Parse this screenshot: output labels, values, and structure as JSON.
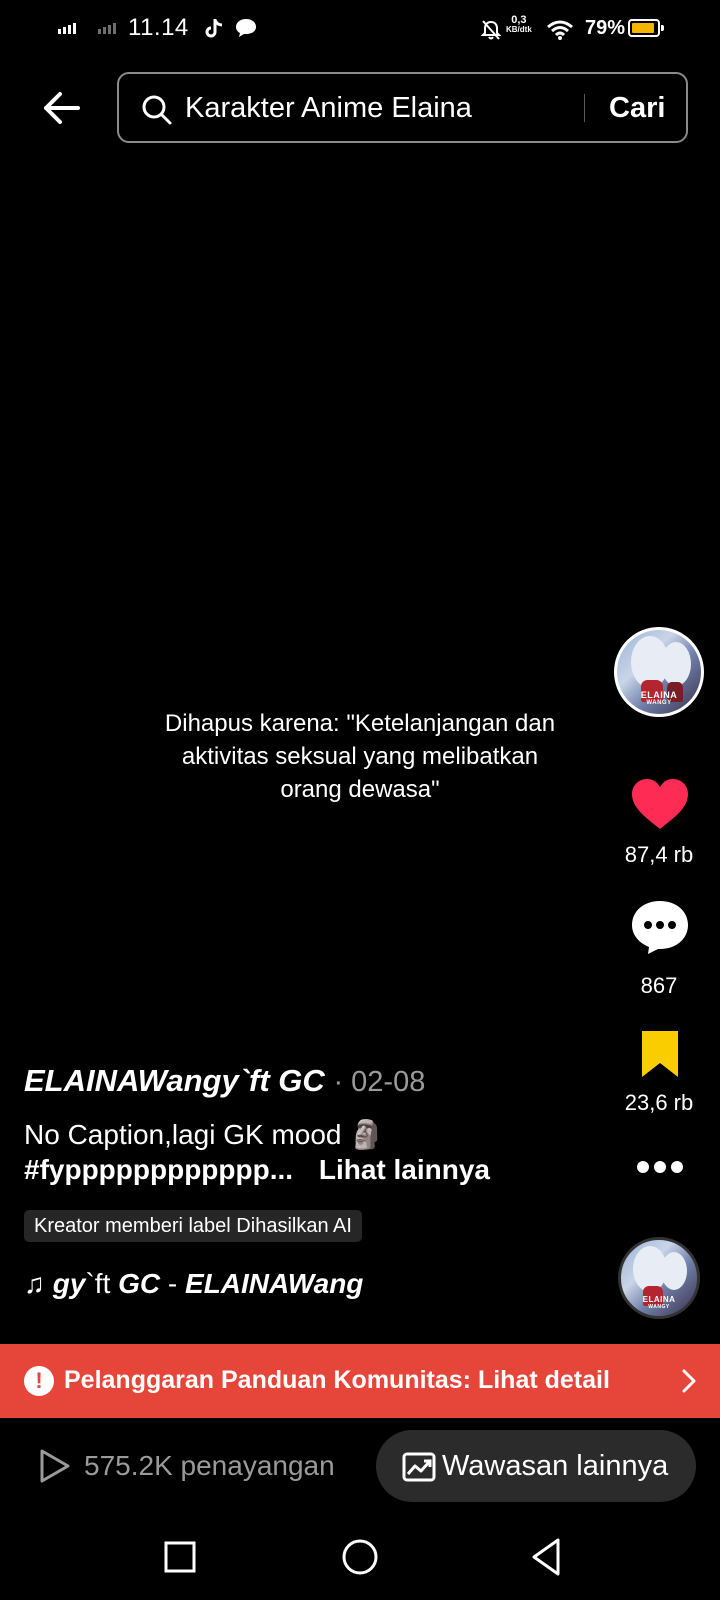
{
  "status_bar": {
    "time": "11.14",
    "net_speed_value": "0,3",
    "net_speed_unit": "KB/dtk",
    "battery_percent": "79%",
    "battery_level": 0.79,
    "icons": [
      "signal-icon",
      "signal-secondary-icon",
      "tiktok-icon",
      "chat-bubble-icon",
      "mute-bell-icon",
      "wifi-icon",
      "battery-icon"
    ]
  },
  "search": {
    "query": "Karakter Anime Elaina",
    "submit_label": "Cari"
  },
  "video": {
    "removed_notice": "Dihapus karena: \"Ketelanjangan dan aktivitas seksual yang melibatkan orang dewasa\""
  },
  "actions": {
    "likes": "87,4 rb",
    "comments": "867",
    "saves": "23,6 rb",
    "like_color": "#fe2c55",
    "save_color": "#facd00"
  },
  "post": {
    "author": "ELAINAWangy`ft GC",
    "date": "· 02-08",
    "caption": "No Caption,lagi GK mood 🗿",
    "hashtag": "#fypppppppppppp...",
    "see_more": "Lihat lainnya",
    "ai_label": "Kreator memberi label Dihasilkan AI",
    "music_note": "♫",
    "music_part1": "gy",
    "music_part2": "`ft ",
    "music_part3": "GC",
    "music_part4": " - ",
    "music_part5": "ELAINAWang",
    "avatar_text": "ELAINA",
    "avatar_subtext": "WANGY"
  },
  "violation": {
    "text": "Pelanggaran Panduan Komunitas: Lihat detail",
    "color": "#e6453a"
  },
  "insights": {
    "views": "575.2K penayangan",
    "button_label": "Wawasan lainnya"
  }
}
